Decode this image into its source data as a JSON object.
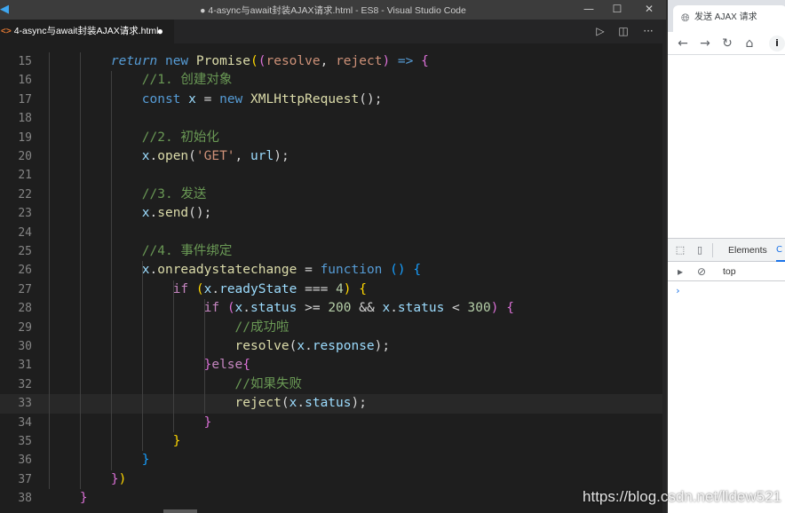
{
  "window": {
    "title": "● 4-async与await封装AJAX请求.html - ES8 - Visual Studio Code",
    "logo_icon": "vscode-logo-icon",
    "minimize": "—",
    "maximize": "☐",
    "close": "✕"
  },
  "tab": {
    "icon": "<>",
    "label": "4-async与await封装AJAX请求.html",
    "dirty_marker": "●"
  },
  "editor_actions": {
    "run": "▷",
    "split": "◫",
    "more": "···"
  },
  "editor": {
    "line_numbers": [
      "15",
      "16",
      "17",
      "18",
      "19",
      "20",
      "21",
      "22",
      "23",
      "24",
      "25",
      "26",
      "27",
      "28",
      "29",
      "30",
      "31",
      "32",
      "33",
      "34",
      "35",
      "36",
      "37",
      "38"
    ],
    "current_line": "33",
    "lines": [
      {
        "n": "15",
        "tokens": [
          {
            "t": "        "
          },
          {
            "t": "return",
            "c": "kwi"
          },
          {
            "t": " "
          },
          {
            "t": "new",
            "c": "kw"
          },
          {
            "t": " "
          },
          {
            "t": "Promise",
            "c": "fn"
          },
          {
            "t": "(",
            "c": "paren"
          },
          {
            "t": "(",
            "c": "paren2"
          },
          {
            "t": "resolve",
            "c": "str"
          },
          {
            "t": ", "
          },
          {
            "t": "reject",
            "c": "str"
          },
          {
            "t": ")",
            "c": "paren2"
          },
          {
            "t": " "
          },
          {
            "t": "=>",
            "c": "kw"
          },
          {
            "t": " "
          },
          {
            "t": "{",
            "c": "paren2"
          }
        ]
      },
      {
        "n": "16",
        "tokens": [
          {
            "t": "            "
          },
          {
            "t": "//1. 创建对象",
            "c": "cmt"
          }
        ]
      },
      {
        "n": "17",
        "tokens": [
          {
            "t": "            "
          },
          {
            "t": "const",
            "c": "kw"
          },
          {
            "t": " "
          },
          {
            "t": "x",
            "c": "var"
          },
          {
            "t": " = "
          },
          {
            "t": "new",
            "c": "kw"
          },
          {
            "t": " "
          },
          {
            "t": "XMLHttpRequest",
            "c": "fn"
          },
          {
            "t": "();"
          }
        ]
      },
      {
        "n": "18",
        "tokens": []
      },
      {
        "n": "19",
        "tokens": [
          {
            "t": "            "
          },
          {
            "t": "//2. 初始化",
            "c": "cmt"
          }
        ]
      },
      {
        "n": "20",
        "tokens": [
          {
            "t": "            "
          },
          {
            "t": "x",
            "c": "var"
          },
          {
            "t": "."
          },
          {
            "t": "open",
            "c": "fn"
          },
          {
            "t": "("
          },
          {
            "t": "'GET'",
            "c": "str"
          },
          {
            "t": ", "
          },
          {
            "t": "url",
            "c": "var"
          },
          {
            "t": ");"
          }
        ]
      },
      {
        "n": "21",
        "tokens": []
      },
      {
        "n": "22",
        "tokens": [
          {
            "t": "            "
          },
          {
            "t": "//3. 发送",
            "c": "cmt"
          }
        ]
      },
      {
        "n": "23",
        "tokens": [
          {
            "t": "            "
          },
          {
            "t": "x",
            "c": "var"
          },
          {
            "t": "."
          },
          {
            "t": "send",
            "c": "fn"
          },
          {
            "t": "();"
          }
        ]
      },
      {
        "n": "24",
        "tokens": []
      },
      {
        "n": "25",
        "tokens": [
          {
            "t": "            "
          },
          {
            "t": "//4. 事件绑定",
            "c": "cmt"
          }
        ]
      },
      {
        "n": "26",
        "tokens": [
          {
            "t": "            "
          },
          {
            "t": "x",
            "c": "var"
          },
          {
            "t": "."
          },
          {
            "t": "onreadystatechange",
            "c": "fn"
          },
          {
            "t": " = "
          },
          {
            "t": "function",
            "c": "kw"
          },
          {
            "t": " "
          },
          {
            "t": "()",
            "c": "paren3"
          },
          {
            "t": " "
          },
          {
            "t": "{",
            "c": "paren3"
          }
        ]
      },
      {
        "n": "27",
        "tokens": [
          {
            "t": "                "
          },
          {
            "t": "if",
            "c": "cf"
          },
          {
            "t": " "
          },
          {
            "t": "(",
            "c": "paren"
          },
          {
            "t": "x",
            "c": "var"
          },
          {
            "t": "."
          },
          {
            "t": "readyState",
            "c": "var"
          },
          {
            "t": " === "
          },
          {
            "t": "4",
            "c": "num"
          },
          {
            "t": ")",
            "c": "paren"
          },
          {
            "t": " "
          },
          {
            "t": "{",
            "c": "paren"
          }
        ]
      },
      {
        "n": "28",
        "tokens": [
          {
            "t": "                    "
          },
          {
            "t": "if",
            "c": "cf"
          },
          {
            "t": " "
          },
          {
            "t": "(",
            "c": "paren2"
          },
          {
            "t": "x",
            "c": "var"
          },
          {
            "t": "."
          },
          {
            "t": "status",
            "c": "var"
          },
          {
            "t": " >= "
          },
          {
            "t": "200",
            "c": "num"
          },
          {
            "t": " && "
          },
          {
            "t": "x",
            "c": "var"
          },
          {
            "t": "."
          },
          {
            "t": "status",
            "c": "var"
          },
          {
            "t": " < "
          },
          {
            "t": "300",
            "c": "num"
          },
          {
            "t": ")",
            "c": "paren2"
          },
          {
            "t": " "
          },
          {
            "t": "{",
            "c": "paren2"
          }
        ]
      },
      {
        "n": "29",
        "tokens": [
          {
            "t": "                        "
          },
          {
            "t": "//成功啦",
            "c": "cmt"
          }
        ]
      },
      {
        "n": "30",
        "tokens": [
          {
            "t": "                        "
          },
          {
            "t": "resolve",
            "c": "fn"
          },
          {
            "t": "("
          },
          {
            "t": "x",
            "c": "var"
          },
          {
            "t": "."
          },
          {
            "t": "response",
            "c": "var"
          },
          {
            "t": ");"
          }
        ]
      },
      {
        "n": "31",
        "tokens": [
          {
            "t": "                    "
          },
          {
            "t": "}",
            "c": "paren2"
          },
          {
            "t": "else",
            "c": "cf"
          },
          {
            "t": "{",
            "c": "paren2"
          }
        ]
      },
      {
        "n": "32",
        "tokens": [
          {
            "t": "                        "
          },
          {
            "t": "//如果失败",
            "c": "cmt"
          }
        ]
      },
      {
        "n": "33",
        "tokens": [
          {
            "t": "                        "
          },
          {
            "t": "reject",
            "c": "fn"
          },
          {
            "t": "("
          },
          {
            "t": "x",
            "c": "var"
          },
          {
            "t": "."
          },
          {
            "t": "status",
            "c": "var"
          },
          {
            "t": ");"
          }
        ]
      },
      {
        "n": "34",
        "tokens": [
          {
            "t": "                    "
          },
          {
            "t": "}",
            "c": "paren2"
          }
        ]
      },
      {
        "n": "35",
        "tokens": [
          {
            "t": "                "
          },
          {
            "t": "}",
            "c": "paren"
          }
        ]
      },
      {
        "n": "36",
        "tokens": [
          {
            "t": "            "
          },
          {
            "t": "}",
            "c": "paren3"
          }
        ]
      },
      {
        "n": "37",
        "tokens": [
          {
            "t": "        "
          },
          {
            "t": "}",
            "c": "paren2"
          },
          {
            "t": ")",
            "c": "paren"
          }
        ]
      },
      {
        "n": "38",
        "tokens": [
          {
            "t": "    "
          },
          {
            "t": "}",
            "c": "paren2"
          }
        ]
      }
    ]
  },
  "browser": {
    "tab_title": "发送 AJAX 请求",
    "tab_icon": "globe-icon",
    "back": "←",
    "forward": "→",
    "reload": "↻",
    "home": "⌂",
    "info": "i"
  },
  "devtools": {
    "inspect_icon": "inspect-icon",
    "device_icon": "device-toggle-icon",
    "elements_tab": "Elements",
    "console_tab": "C",
    "context": "top",
    "prompt": "›"
  },
  "watermark": "https://blog.csdn.net/lldew521"
}
